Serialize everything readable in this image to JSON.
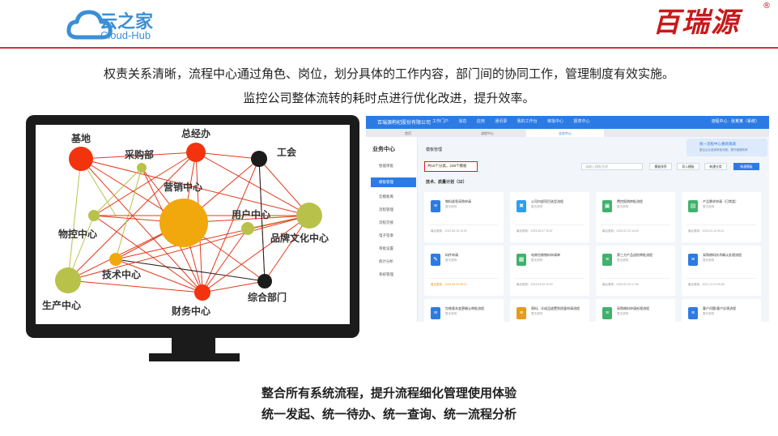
{
  "header": {
    "brand_cn": "云之家",
    "brand_en": "Cloud-Hub",
    "partner_logo": "百瑞源",
    "partner_reg": "®",
    "accent": "#d8302c",
    "brand_color": "#3a8fd6"
  },
  "intro": {
    "line1": "权责关系清晰，流程中心通过角色、岗位，划分具体的工作内容，部门间的协同工作，管理制度有效实施。",
    "line2": "监控公司整体流转的耗时点进行优化改进，提升效率。"
  },
  "network": {
    "labels": {
      "base": "基地",
      "gm": "总经办",
      "purchasing": "采购部",
      "union": "工会",
      "marketing": "营销中心",
      "user": "用户中心",
      "logistics": "物控中心",
      "brand": "品牌文化中心",
      "tech": "技术中心",
      "production": "生产中心",
      "finance": "财务中心",
      "general": "综合部门"
    }
  },
  "app": {
    "top_title": "百瑞源枸杞股份有限公司",
    "top_nav": [
      "工作门户",
      "消息",
      "应用",
      "通讯录",
      "我的工作台",
      "审批中心",
      "报表中心"
    ],
    "top_right": "流程中心 · 张某某（系统）",
    "tabs": [
      "首页",
      "流程中心",
      "业务中心"
    ],
    "sidebar_title": "业务中心",
    "sidebar_items": [
      "智能审批",
      "模板管理",
      "云模板库",
      "流程管理",
      "流程交接",
      "电子签章",
      "审批设置",
      "统计分析",
      "系统管理"
    ],
    "main_title": "模板管理",
    "banner_title": "统一流程中心重磅来袭",
    "banner_sub": "整合企业各类审批流程，提升管理效率",
    "count_text": "共18个分类，238个模板",
    "search_placeholder": "请输入模板名称",
    "buttons": [
      "模板排序",
      "导入模板",
      "新建分类",
      "新建模板"
    ],
    "section_title": "技术、质量计划（32）",
    "cards": [
      {
        "name": "物料紧急采购申请",
        "sub": "暂无说明",
        "date": "最后更新：2023.06.19 10:00",
        "color": "#2c7be5",
        "icon": "doc-icon"
      },
      {
        "name": "公司内部项目选型流程",
        "sub": "暂无说明",
        "date": "最后更新：2023.06.07 15:57",
        "color": "#2c9ef0",
        "icon": "tools-icon"
      },
      {
        "name": "费控报销审批流程",
        "sub": "暂无说明",
        "date": "最后更新：2023.02.22 16:49",
        "color": "#3fb26b",
        "icon": "car-icon"
      },
      {
        "name": "产品需求申请（日常类）",
        "sub": "暂无说明",
        "date": "最后更新：2023.04.19 09:11",
        "color": "#3fb26b",
        "icon": "briefcase-icon"
      },
      {
        "name": "料件申请",
        "sub": "暂无说明",
        "date": "最近更新：2023.06.20 08:11",
        "color": "#2c7be5",
        "icon": "pen-icon",
        "warn": true
      },
      {
        "name": "电商包装物料申请单",
        "sub": "暂无说明",
        "date": "最后更新：2023.03.09 15:20",
        "color": "#3fb26b",
        "icon": "box-icon"
      },
      {
        "name": "第三方产品送检审批流程",
        "sub": "暂无说明",
        "date": "最后更新：2023.02.20 17:05",
        "color": "#3fb26b",
        "icon": "doc-icon"
      },
      {
        "name": "采购物料技术确认处理流程",
        "sub": "暂无说明",
        "date": "最后更新：2021.12.21 09:55",
        "color": "#2c7be5",
        "icon": "doc-icon"
      },
      {
        "name": "包装版本变更确认审批流程",
        "sub": "暂无说明",
        "date": "",
        "color": "#2c7be5",
        "icon": "doc-icon"
      },
      {
        "name": "原料、半成品放置到质量申请流程",
        "sub": "暂无说明",
        "date": "",
        "color": "#e99a1c",
        "icon": "doc-icon"
      },
      {
        "name": "采购物料申请处理流程",
        "sub": "暂无说明",
        "date": "",
        "color": "#3fb26b",
        "icon": "doc-icon"
      },
      {
        "name": "客户问题/客户反馈流程",
        "sub": "暂无说明",
        "date": "",
        "color": "#2c7be5",
        "icon": "doc-icon"
      }
    ]
  },
  "summary": {
    "line1": "整合所有系统流程，提升流程细化管理使用体验",
    "line2": "统一发起、统一待办、统一查询、统一流程分析"
  }
}
